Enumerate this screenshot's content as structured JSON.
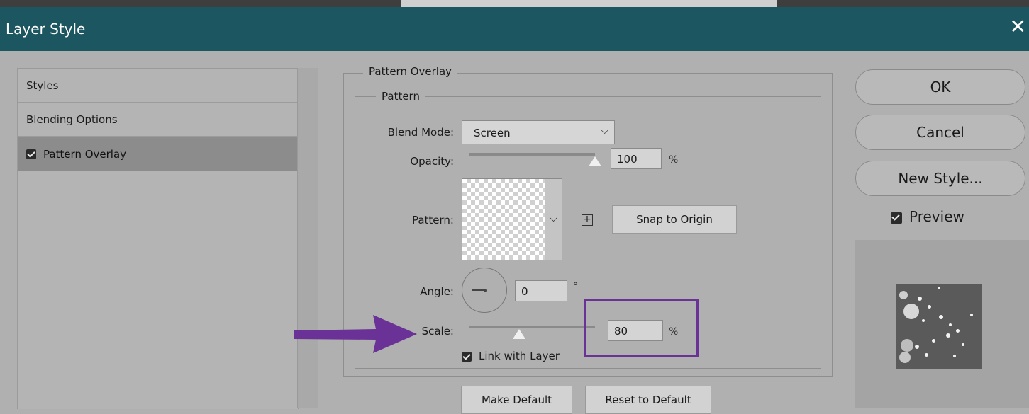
{
  "dialog": {
    "title": "Layer Style"
  },
  "styles_list": {
    "items": [
      {
        "label": "Styles"
      },
      {
        "label": "Blending Options"
      },
      {
        "label": "Pattern Overlay",
        "checked": true
      }
    ]
  },
  "pattern_overlay": {
    "group_title": "Pattern Overlay",
    "subgroup_title": "Pattern",
    "blend_mode_label": "Blend Mode:",
    "blend_mode_value": "Screen",
    "opacity_label": "Opacity:",
    "opacity_value": "100",
    "opacity_unit": "%",
    "opacity_fraction": 1.0,
    "pattern_label": "Pattern:",
    "snap_to_origin_label": "Snap to Origin",
    "angle_label": "Angle:",
    "angle_value": "0",
    "angle_unit": "°",
    "scale_label": "Scale:",
    "scale_value": "80",
    "scale_unit": "%",
    "scale_fraction": 0.4,
    "link_with_layer_label": "Link with Layer",
    "link_with_layer_checked": true,
    "make_default_label": "Make Default",
    "reset_to_default_label": "Reset to Default"
  },
  "actions": {
    "ok_label": "OK",
    "cancel_label": "Cancel",
    "new_style_label": "New Style...",
    "preview_label": "Preview",
    "preview_checked": true
  },
  "colors": {
    "titlebar": "#1c5660",
    "annotation": "#6a3196",
    "dialog_bg": "#b0b0b0"
  },
  "icons": {
    "close": "close-icon",
    "caret": "chevron-down-icon",
    "new_preset": "plus-square-icon",
    "arrow": "annotation-arrow-icon"
  }
}
